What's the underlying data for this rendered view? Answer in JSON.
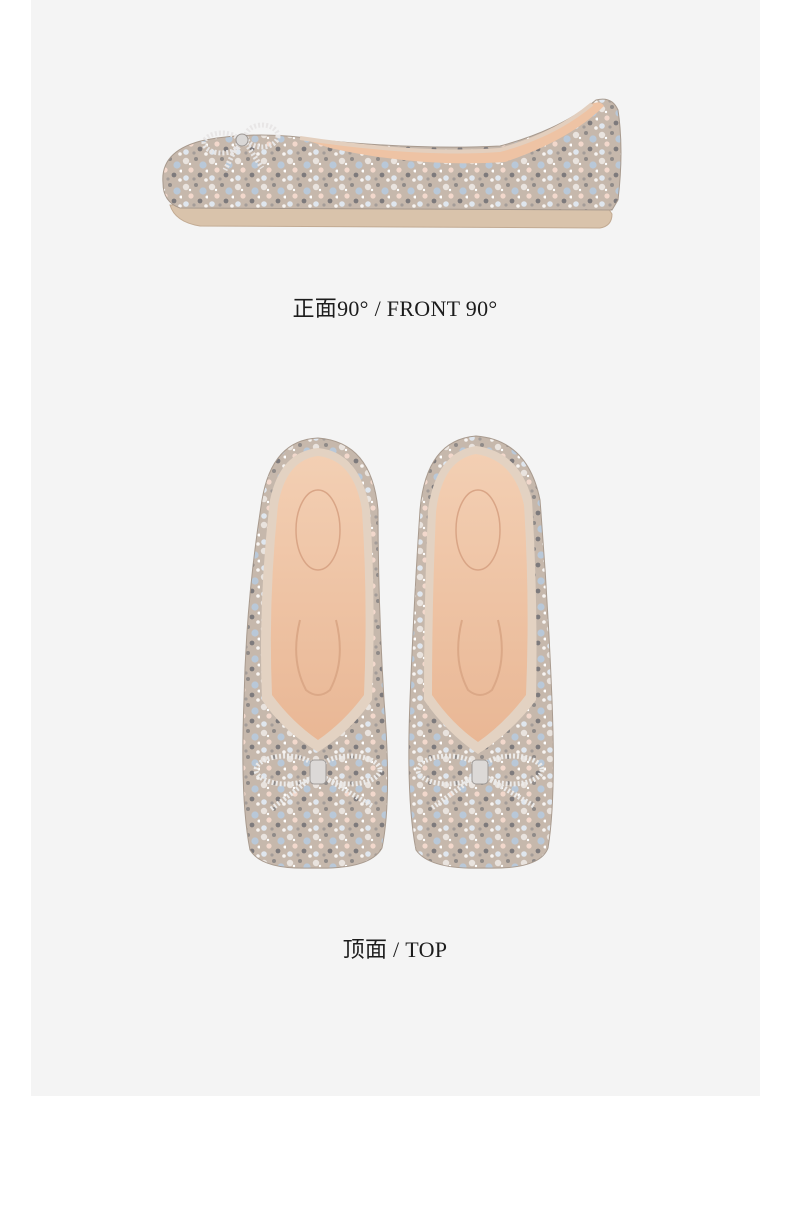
{
  "views": {
    "front": {
      "caption": "正面90° / FRONT 90°"
    },
    "top": {
      "caption": "顶面 / TOP"
    }
  },
  "colors": {
    "panel_background": "#f4f4f4",
    "page_background": "#ffffff",
    "caption_text": "#1c1c1c",
    "shoe_sparkle_base": "#c9bcb0",
    "insole": "#eec3a4",
    "sole": "#d6bfa7"
  }
}
